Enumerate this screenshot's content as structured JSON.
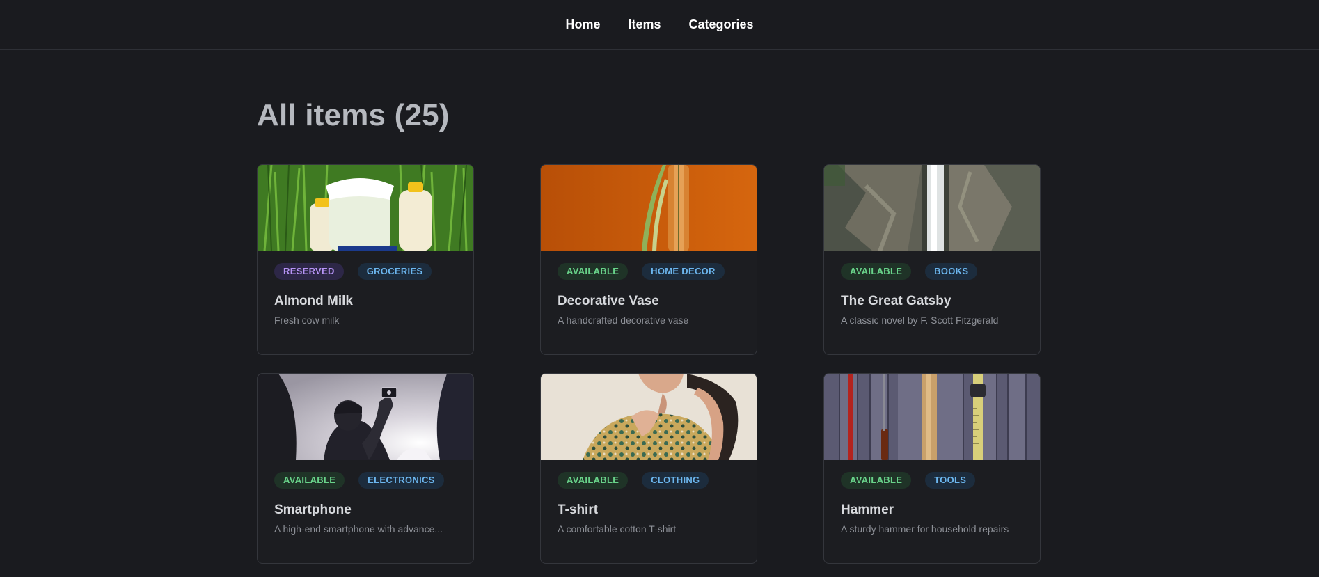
{
  "nav": {
    "links": [
      "Home",
      "Items",
      "Categories"
    ]
  },
  "page": {
    "title": "All items (25)"
  },
  "colors": {
    "background": "#1a1b1f",
    "reserved": "#b794f6",
    "available": "#69d38a",
    "category": "#6cb6ee"
  },
  "items": [
    {
      "status": "RESERVED",
      "category": "GROCERIES",
      "title": "Almond Milk",
      "description": "Fresh cow milk",
      "image": "milk-bottles-in-grass"
    },
    {
      "status": "AVAILABLE",
      "category": "HOME DECOR",
      "title": "Decorative Vase",
      "description": "A handcrafted decorative vase",
      "image": "glass-vase-orange-wall"
    },
    {
      "status": "AVAILABLE",
      "category": "BOOKS",
      "title": "The Great Gatsby",
      "description": "A classic novel by F. Scott Fitzgerald",
      "image": "waterfall-rock-cliff"
    },
    {
      "status": "AVAILABLE",
      "category": "ELECTRONICS",
      "title": "Smartphone",
      "description": "A high-end smartphone with advance...",
      "image": "silhouette-taking-photo"
    },
    {
      "status": "AVAILABLE",
      "category": "CLOTHING",
      "title": "T-shirt",
      "description": "A comfortable cotton T-shirt",
      "image": "woman-floral-shirt"
    },
    {
      "status": "AVAILABLE",
      "category": "TOOLS",
      "title": "Hammer",
      "description": "A sturdy hammer for household repairs",
      "image": "tools-on-wood-wall"
    }
  ]
}
